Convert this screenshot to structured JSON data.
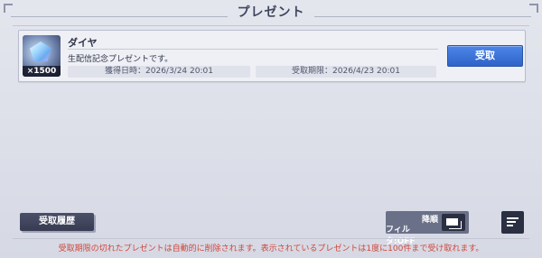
{
  "header": {
    "title": "プレゼント"
  },
  "items": [
    {
      "name": "ダイヤ",
      "quantity": "×1500",
      "description": "生配信記念プレゼントです。",
      "acquired": "獲得日時：2026/3/24 20:01",
      "expires": "受取期限：2026/4/23 20:01",
      "receive_label": "受取"
    }
  ],
  "footer": {
    "history_label": "受取履歴",
    "sort_order": "降順",
    "filter_status": "フィルタ:OFF",
    "notice": "受取期限の切れたプレゼントは自動的に削除されます。表示されているプレゼントは1度に100件まで受け取れます。"
  },
  "colors": {
    "accent_button": "#3a70d8",
    "notice_text": "#d2453a",
    "dark_button": "#383c52"
  },
  "icons": [
    "diamond-gem-icon",
    "filter-icon",
    "sort-icon"
  ]
}
